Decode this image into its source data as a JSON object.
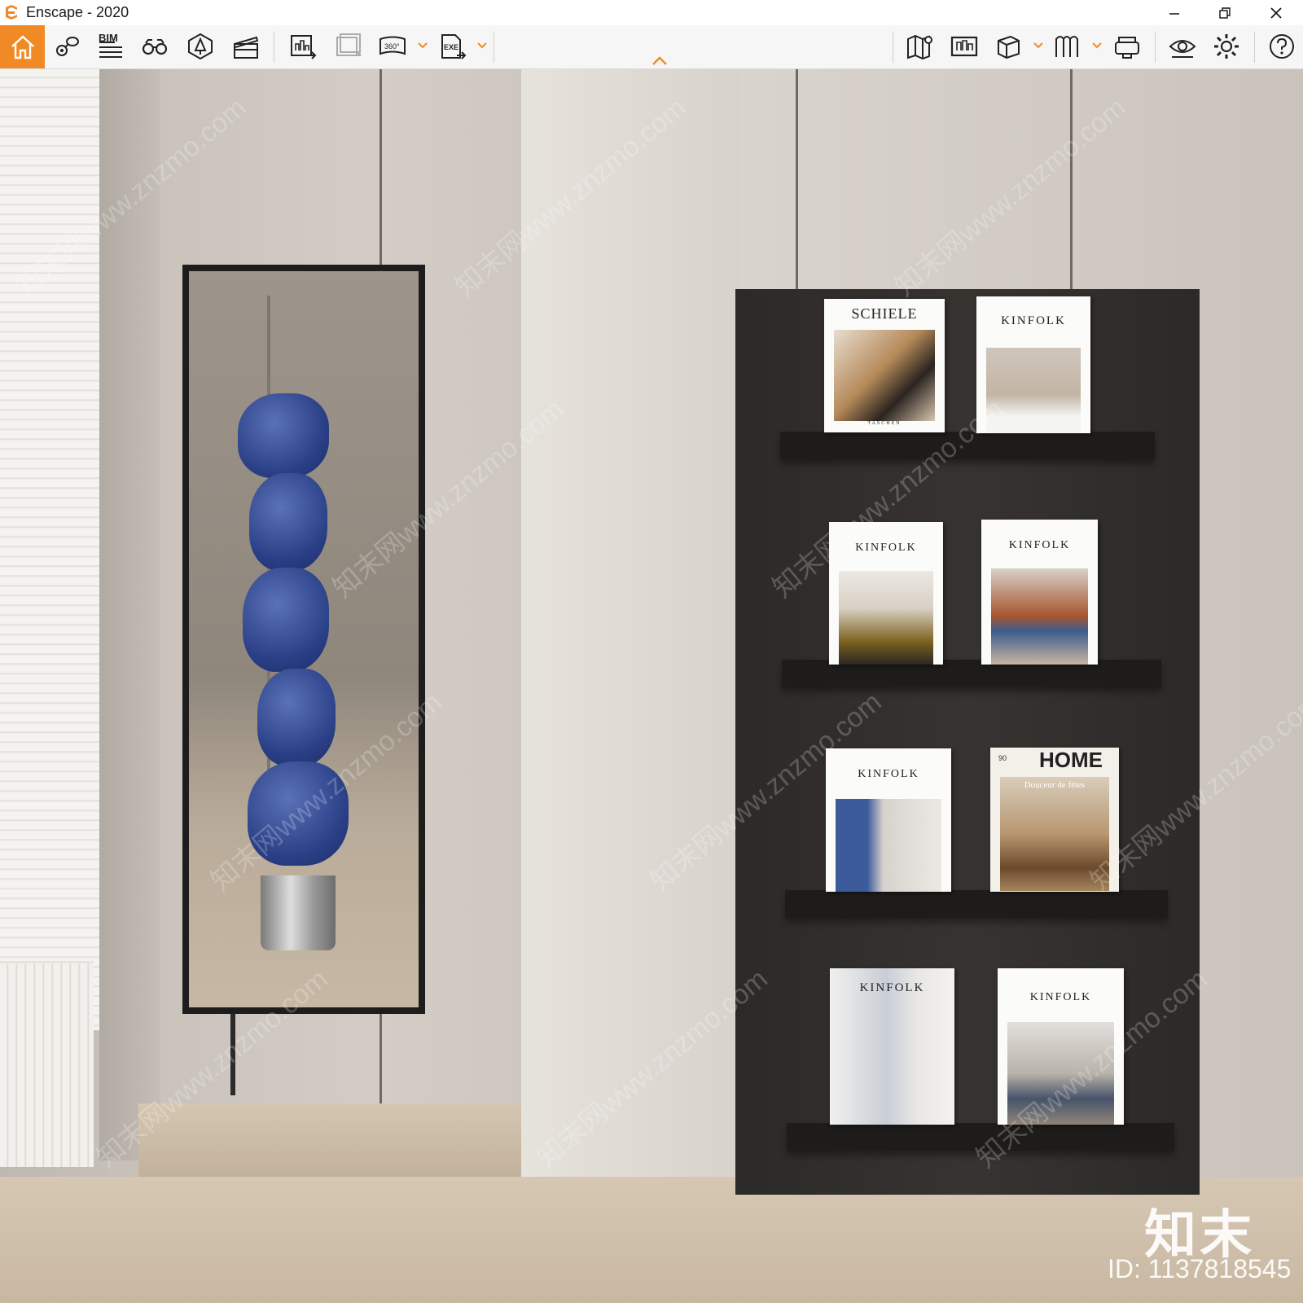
{
  "window": {
    "title": "Enscape - 2020"
  },
  "toolbar": {
    "bim_label": "BIM"
  },
  "books": [
    {
      "title": "SCHIELE",
      "subtitle": "TASCHEN"
    },
    {
      "title": "KINFOLK"
    },
    {
      "title": "KINFOLK"
    },
    {
      "title": "KINFOLK"
    },
    {
      "title": "KINFOLK"
    },
    {
      "title": "HOME",
      "issue": "90",
      "subtitle": "Douceur de fêtes"
    },
    {
      "title": "KINFOLK"
    },
    {
      "title": "KINFOLK"
    }
  ],
  "watermark": {
    "site": "知末网www.znzmo.com",
    "brand": "知末",
    "id": "ID: 1137818545"
  },
  "colors": {
    "accent": "#f08a24",
    "sculpture": "#2a3f86",
    "shelf": "#2c2a28"
  }
}
